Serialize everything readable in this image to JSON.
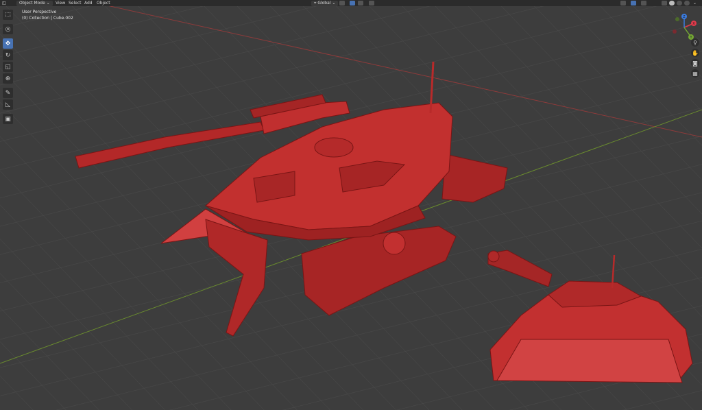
{
  "header": {
    "editor_type_icon": "cube-icon",
    "mode": "Object Mode",
    "menus": [
      "View",
      "Select",
      "Add",
      "Object"
    ],
    "transform_orientation": "Global"
  },
  "viewport_info": {
    "perspective": "User Perspective",
    "collection": "(0) Collection | Cube.002"
  },
  "toolbar": {
    "tools": [
      "select-box-icon",
      "cursor-icon",
      "move-icon",
      "rotate-icon",
      "scale-icon",
      "transform-icon",
      "annotate-icon",
      "measure-icon",
      "add-cube-icon"
    ],
    "active_tool": "move-icon"
  },
  "navigation_gizmo": {
    "axes": [
      "X",
      "Y",
      "Z"
    ],
    "colors": {
      "x": "#e23a4b",
      "y": "#74a734",
      "z": "#3b7ce1"
    }
  },
  "nav_buttons": [
    "zoom-icon",
    "hand-icon",
    "camera-icon",
    "grid-icon"
  ],
  "colors": {
    "viewport_bg": "#3d3d3d",
    "header_bg": "#2b2b2b",
    "model": "#b82a2a",
    "active_tool": "#4772b3",
    "x_axis": "#8f3b3b",
    "y_axis": "#6a8c2e"
  }
}
